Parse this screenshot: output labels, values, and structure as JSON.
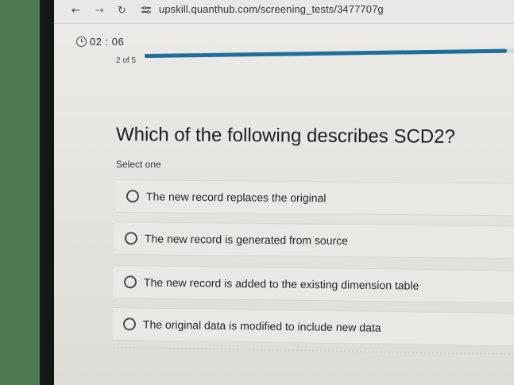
{
  "browser": {
    "url": "upskill.quanthub.com/screening_tests/3477707g"
  },
  "timer": {
    "value": "02 : 06"
  },
  "progress": {
    "label": "2 of 5",
    "fraction": 0.97,
    "fill_color": "#1f6f9a"
  },
  "question": {
    "text": "Which of the following describes SCD2?",
    "instruction": "Select one",
    "options": [
      {
        "label": "The new record replaces the original"
      },
      {
        "label": "The new record is generated from source"
      },
      {
        "label": "The new record is added to the existing dimension table"
      },
      {
        "label": "The original data is modified to include new data"
      }
    ]
  }
}
